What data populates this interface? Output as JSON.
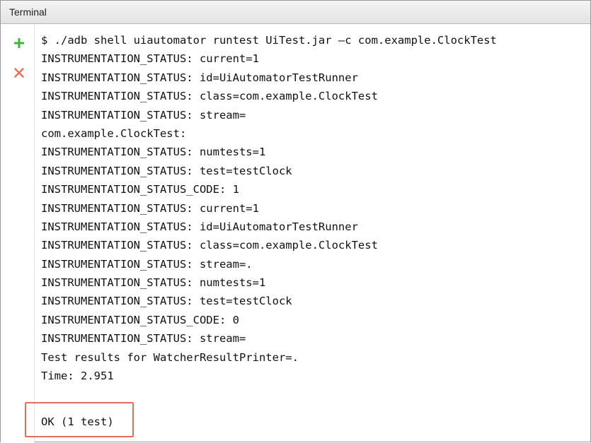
{
  "panel": {
    "title": "Terminal"
  },
  "toolbar": {
    "add_icon": "plus-icon",
    "close_icon": "close-icon",
    "add_color": "#3db83d",
    "close_color": "#e8735e"
  },
  "output": {
    "lines": [
      "$ ./adb shell uiautomator runtest UiTest.jar –c com.example.ClockTest",
      "INSTRUMENTATION_STATUS: current=1",
      "INSTRUMENTATION_STATUS: id=UiAutomatorTestRunner",
      "INSTRUMENTATION_STATUS: class=com.example.ClockTest",
      "INSTRUMENTATION_STATUS: stream=",
      "com.example.ClockTest:",
      "INSTRUMENTATION_STATUS: numtests=1",
      "INSTRUMENTATION_STATUS: test=testClock",
      "INSTRUMENTATION_STATUS_CODE: 1",
      "INSTRUMENTATION_STATUS: current=1",
      "INSTRUMENTATION_STATUS: id=UiAutomatorTestRunner",
      "INSTRUMENTATION_STATUS: class=com.example.ClockTest",
      "INSTRUMENTATION_STATUS: stream=.",
      "INSTRUMENTATION_STATUS: numtests=1",
      "INSTRUMENTATION_STATUS: test=testClock",
      "INSTRUMENTATION_STATUS_CODE: 0",
      "INSTRUMENTATION_STATUS: stream=",
      "Test results for WatcherResultPrinter=.",
      "Time: 2.951"
    ],
    "result": "OK (1 test)",
    "highlight_color": "#e07060"
  }
}
